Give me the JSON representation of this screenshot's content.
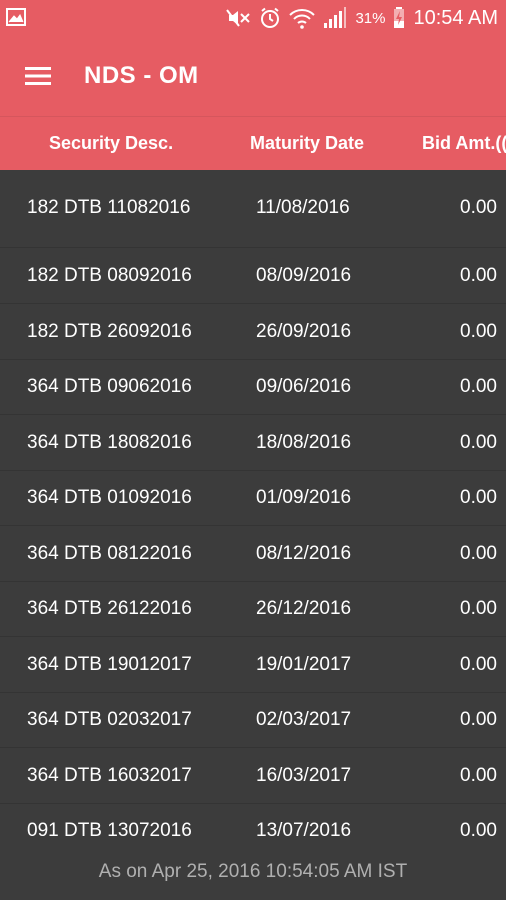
{
  "status_bar": {
    "battery": "31%",
    "time": "10:54 AM"
  },
  "toolbar": {
    "title": "NDS - OM"
  },
  "table": {
    "headers": [
      "Security Desc.",
      "Maturity Date",
      "Bid Amt.(("
    ],
    "rows": [
      [
        "182 DTB 11082016",
        "11/08/2016",
        "0.00"
      ],
      [
        "182 DTB 08092016",
        "08/09/2016",
        "0.00"
      ],
      [
        "182 DTB 26092016",
        "26/09/2016",
        "0.00"
      ],
      [
        "364 DTB 09062016",
        "09/06/2016",
        "0.00"
      ],
      [
        "364 DTB 18082016",
        "18/08/2016",
        "0.00"
      ],
      [
        "364 DTB 01092016",
        "01/09/2016",
        "0.00"
      ],
      [
        "364 DTB 08122016",
        "08/12/2016",
        "0.00"
      ],
      [
        "364 DTB 26122016",
        "26/12/2016",
        "0.00"
      ],
      [
        "364 DTB 19012017",
        "19/01/2017",
        "0.00"
      ],
      [
        "364 DTB 02032017",
        "02/03/2017",
        "0.00"
      ],
      [
        "364 DTB 16032017",
        "16/03/2017",
        "0.00"
      ],
      [
        "091 DTB 13072016",
        "13/07/2016",
        "0.00"
      ]
    ]
  },
  "footer": {
    "timestamp": "As on Apr 25, 2016 10:54:05 AM IST"
  },
  "colors": {
    "accent": "#e65c63",
    "background": "#3c3c3c",
    "footer_text": "#b0b0b0"
  },
  "icons": [
    "image-notification-icon",
    "mute-icon",
    "alarm-icon",
    "wifi-icon",
    "signal-icon",
    "battery-charging-icon",
    "hamburger-menu-icon"
  ]
}
